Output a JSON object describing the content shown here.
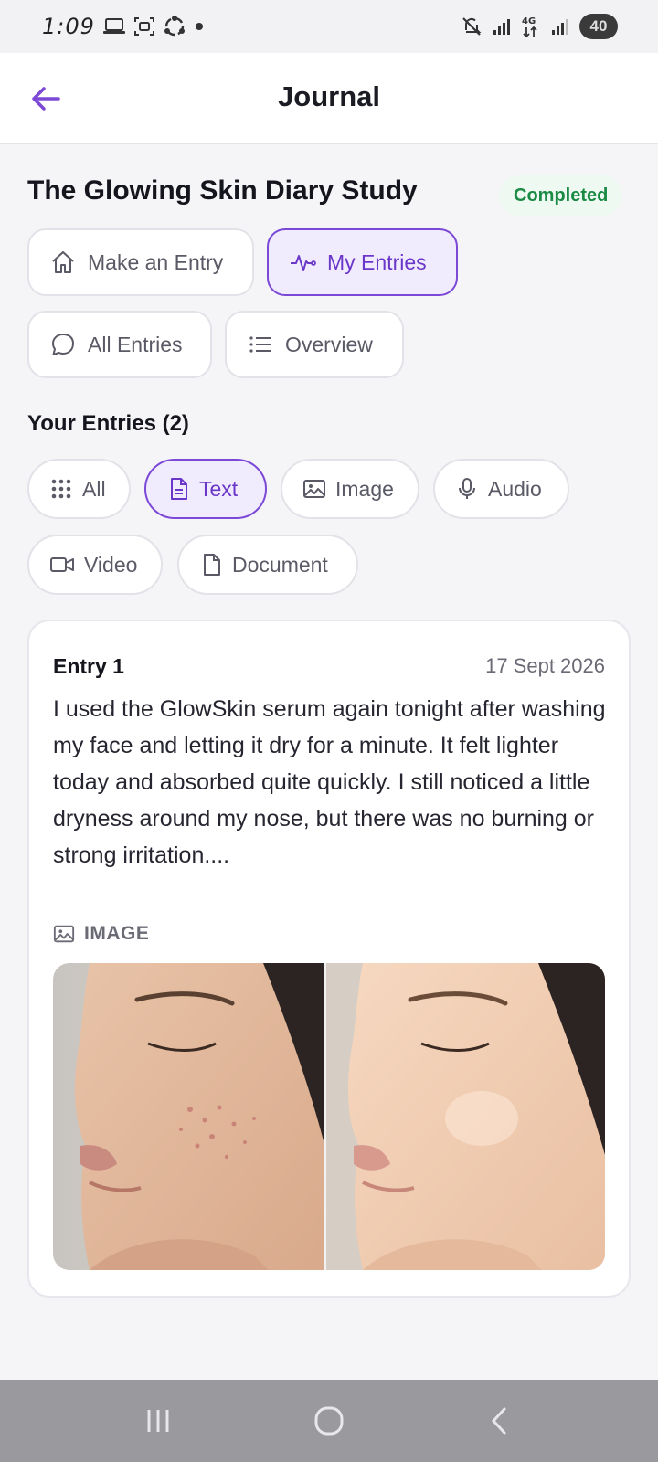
{
  "status_bar": {
    "time": "1:09",
    "battery": "40"
  },
  "app_bar": {
    "title": "Journal"
  },
  "study": {
    "title": "The Glowing Skin Diary Study",
    "status": "Completed"
  },
  "tabs": [
    {
      "label": "Make an Entry",
      "icon": "home-icon",
      "active": false
    },
    {
      "label": "My Entries",
      "icon": "activity-icon",
      "active": true
    },
    {
      "label": "All Entries",
      "icon": "chat-bubble-icon",
      "active": false
    },
    {
      "label": "Overview",
      "icon": "list-icon",
      "active": false
    }
  ],
  "entries_section": {
    "title": "Your Entries (2)"
  },
  "filters": [
    {
      "label": "All",
      "icon": "grid-icon",
      "active": false
    },
    {
      "label": "Text",
      "icon": "document-text-icon",
      "active": true
    },
    {
      "label": "Image",
      "icon": "image-icon",
      "active": false
    },
    {
      "label": "Audio",
      "icon": "microphone-icon",
      "active": false
    },
    {
      "label": "Video",
      "icon": "video-camera-icon",
      "active": false
    },
    {
      "label": "Document",
      "icon": "file-icon",
      "active": false
    }
  ],
  "entry": {
    "title": "Entry 1",
    "date": "17 Sept 2026",
    "body": "I used the GlowSkin serum again tonight after washing my face and letting it dry for a minute. It felt lighter today and absorbed quite quickly. I still noticed a little dryness around my nose, but there was no burning or strong irritation....",
    "attachment_label": "IMAGE"
  },
  "colors": {
    "accent": "#7c48d6",
    "accent_bg": "#f1ecfd",
    "success": "#1a8a45",
    "success_bg": "#eefaf1",
    "nav_bar": "#99999e"
  }
}
